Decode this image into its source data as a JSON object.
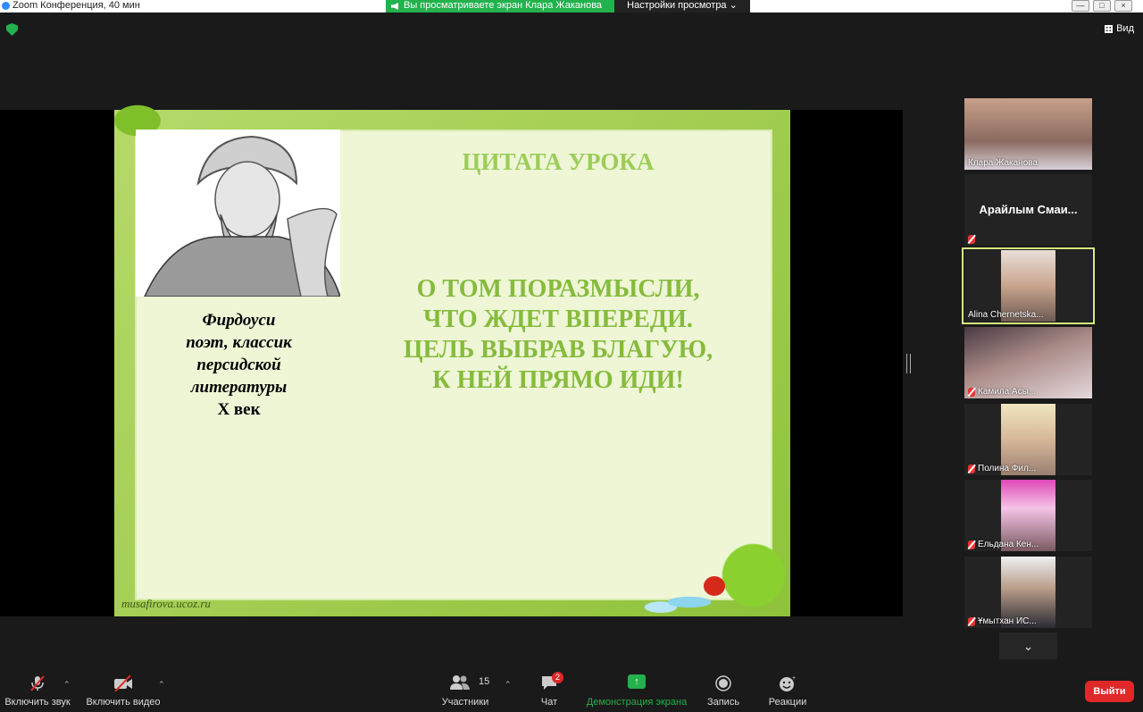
{
  "window": {
    "title": "Zoom Конференция, 40 мин"
  },
  "share_banner": {
    "text": "Вы просматриваете экран Клара Жаканова"
  },
  "view_settings": {
    "label": "Настройки просмотра ⌄"
  },
  "top_right": {
    "view_label": "Вид"
  },
  "slide": {
    "title": "ЦИТАТА УРОКА",
    "quote_lines": [
      "О ТОМ ПОРАЗМЫСЛИ,",
      "ЧТО ЖДЕТ ВПЕРЕДИ.",
      "ЦЕЛЬ ВЫБРАВ БЛАГУЮ,",
      "К НЕЙ ПРЯМО ИДИ!"
    ],
    "caption_lines": [
      "Фирдоуси",
      "поэт, классик",
      "персидской",
      "литературы",
      "X век"
    ],
    "site": "musafirova.ucoz.ru"
  },
  "participants_panel": [
    {
      "name": "Клара Жаканова",
      "muted": false
    },
    {
      "name": "Арайлым  Смаи...",
      "muted": true
    },
    {
      "name": "Alina Chernetska...",
      "muted": false,
      "active": true
    },
    {
      "name": "Камила Асы...",
      "muted": true
    },
    {
      "name": "Полина Фил...",
      "muted": true
    },
    {
      "name": "Ельдана Кен...",
      "muted": true
    },
    {
      "name": "Ұмытхан ИС...",
      "muted": true
    }
  ],
  "scroll_down_glyph": "⌄",
  "toolbar": {
    "unmute_label": "Включить звук",
    "start_video_label": "Включить видео",
    "participants_label": "Участники",
    "participants_count": "15",
    "chat_label": "Чат",
    "chat_badge": "2",
    "share_label": "Демонстрация экрана",
    "record_label": "Запись",
    "reactions_label": "Реакции",
    "leave_label": "Выйти"
  },
  "colors": {
    "share_green": "#23b14d",
    "leave_red": "#e02828",
    "active_outline": "#d7ec7d",
    "slide_text_green": "#86bb3c"
  }
}
